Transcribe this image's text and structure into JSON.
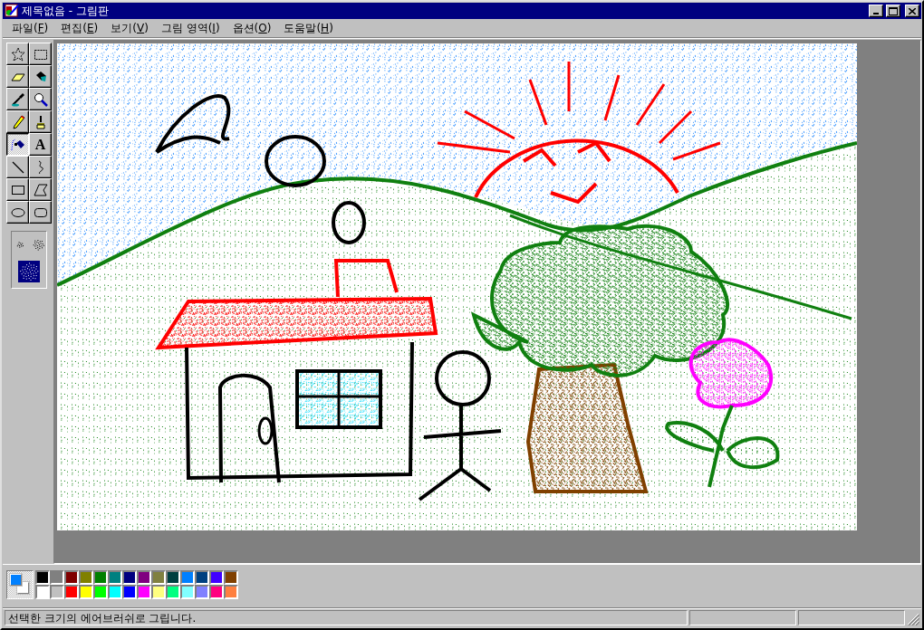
{
  "window": {
    "title": "제목없음 - 그림판"
  },
  "menu": [
    {
      "before": "파일(",
      "mnemonic": "F",
      "after": ")"
    },
    {
      "before": "편집(",
      "mnemonic": "E",
      "after": ")"
    },
    {
      "before": "보기(",
      "mnemonic": "V",
      "after": ")"
    },
    {
      "before": "그림 영역(",
      "mnemonic": "I",
      "after": ")"
    },
    {
      "before": "옵션(",
      "mnemonic": "O",
      "after": ")"
    },
    {
      "before": "도움말(",
      "mnemonic": "H",
      "after": ")"
    }
  ],
  "tools": [
    {
      "kind": "free-select",
      "selected": false
    },
    {
      "kind": "select",
      "selected": false
    },
    {
      "kind": "eraser",
      "selected": false
    },
    {
      "kind": "fill",
      "selected": false
    },
    {
      "kind": "picker",
      "selected": false
    },
    {
      "kind": "magnifier",
      "selected": false
    },
    {
      "kind": "pencil",
      "selected": false
    },
    {
      "kind": "brush",
      "selected": false
    },
    {
      "kind": "airbrush",
      "selected": true
    },
    {
      "kind": "text",
      "selected": false,
      "glyph": "A"
    },
    {
      "kind": "line",
      "selected": false
    },
    {
      "kind": "curve",
      "selected": false
    },
    {
      "kind": "rectangle",
      "selected": false
    },
    {
      "kind": "polygon",
      "selected": false
    },
    {
      "kind": "ellipse",
      "selected": false
    },
    {
      "kind": "rounded-rectangle",
      "selected": false
    }
  ],
  "tool_options": [
    {
      "kind": "spray-small",
      "selected": false
    },
    {
      "kind": "spray-medium",
      "selected": false
    },
    {
      "kind": "spray-large",
      "selected": true
    }
  ],
  "current_colors": [
    {
      "kind": "foreground",
      "color": "#0080ff"
    },
    {
      "kind": "background",
      "color": "#ffffff"
    }
  ],
  "palette": [
    {
      "color": "#000000"
    },
    {
      "color": "#808080"
    },
    {
      "color": "#800000"
    },
    {
      "color": "#808000"
    },
    {
      "color": "#008000"
    },
    {
      "color": "#008080"
    },
    {
      "color": "#000080"
    },
    {
      "color": "#800080"
    },
    {
      "color": "#808040"
    },
    {
      "color": "#004040"
    },
    {
      "color": "#0080ff"
    },
    {
      "color": "#004080"
    },
    {
      "color": "#4000ff"
    },
    {
      "color": "#804000"
    },
    {
      "color": "#ffffff"
    },
    {
      "color": "#c0c0c0"
    },
    {
      "color": "#ff0000"
    },
    {
      "color": "#ffff00"
    },
    {
      "color": "#00ff00"
    },
    {
      "color": "#00ffff"
    },
    {
      "color": "#0000ff"
    },
    {
      "color": "#ff00ff"
    },
    {
      "color": "#ffff80"
    },
    {
      "color": "#00ff80"
    },
    {
      "color": "#80ffff"
    },
    {
      "color": "#8080ff"
    },
    {
      "color": "#ff0080"
    },
    {
      "color": "#ff8040"
    }
  ],
  "status_bar": {
    "text": "선택한 크기의 에어브러쉬로 그립니다."
  }
}
